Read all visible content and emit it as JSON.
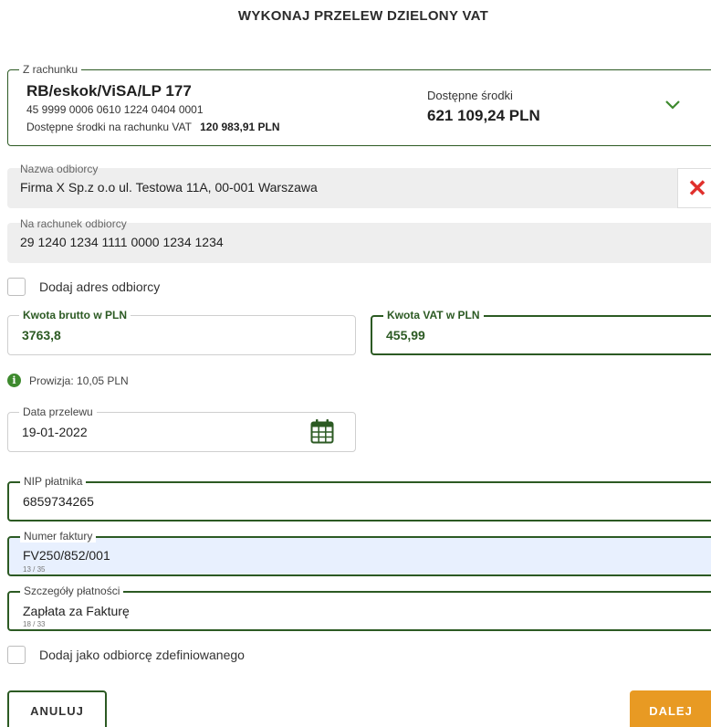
{
  "title": "WYKONAJ PRZELEW DZIELONY VAT",
  "from_account": {
    "legend": "Z rachunku",
    "name": "RB/eskok/ViSA/LP 177",
    "number": "45 9999 0006 0610 1224 0404 0001",
    "vat_label": "Dostępne środki na rachunku VAT",
    "vat_amount": "120 983,91 PLN",
    "available_label": "Dostępne środki",
    "available_amount": "621 109,24 PLN",
    "chevron_icon": "chevron-down-icon"
  },
  "recipient": {
    "label": "Nazwa odbiorcy",
    "value": "Firma X Sp.z o.o ul. Testowa 11A, 00-001 Warszawa",
    "clear_icon": "close-icon",
    "clear_glyph": "✕"
  },
  "recipient_account": {
    "label": "Na rachunek odbiorcy",
    "value": "29 1240 1234 1111 0000 1234 1234"
  },
  "add_address": {
    "label": "Dodaj adres odbiorcy",
    "checked": false
  },
  "gross_amount": {
    "label": "Kwota brutto w PLN",
    "value": "3763,8"
  },
  "vat_amount": {
    "label": "Kwota VAT w PLN",
    "value": "455,99"
  },
  "commission": {
    "icon_glyph": "i",
    "text": "Prowizja: 10,05 PLN"
  },
  "transfer_date": {
    "label": "Data przelewu",
    "value": "19-01-2022",
    "icon": "calendar-icon"
  },
  "nip": {
    "label": "NIP płatnika",
    "value": "6859734265"
  },
  "invoice": {
    "label": "Numer faktury",
    "value": "FV250/852/001",
    "counter": "13 / 35"
  },
  "payment_details": {
    "label": "Szczegóły płatności",
    "value": "Zapłata za Fakturę",
    "counter": "18 / 33"
  },
  "add_defined": {
    "label": "Dodaj jako odbiorcę zdefiniowanego",
    "checked": false
  },
  "buttons": {
    "cancel": "ANULUJ",
    "next": "DALEJ"
  },
  "colors": {
    "accent_green": "#2c5a23",
    "info_green": "#3e8a2e",
    "next_orange": "#e89a23",
    "clear_red": "#e0302c",
    "autofill_blue": "#e8f0fe"
  }
}
